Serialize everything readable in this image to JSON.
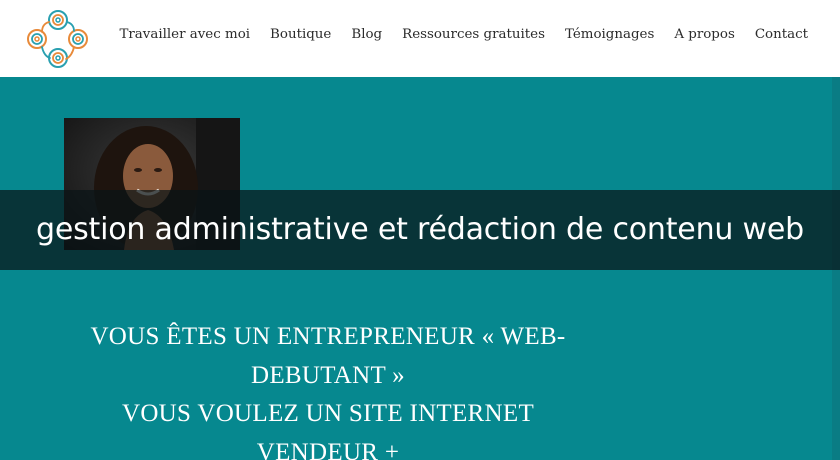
{
  "nav": {
    "items": [
      {
        "label": "Travailler avec moi"
      },
      {
        "label": "Boutique"
      },
      {
        "label": "Blog"
      },
      {
        "label": "Ressources gratuites"
      },
      {
        "label": "Témoignages"
      },
      {
        "label": "A propos"
      },
      {
        "label": "Contact"
      }
    ]
  },
  "logo": {
    "icon": "swirl-logo-icon"
  },
  "hero": {
    "caption": "gestion administrative et rédaction de contenu web",
    "headline_lines": [
      "VOUS ÊTES UN ENTREPRENEUR « WEB-",
      "DEBUTANT »",
      "VOUS VOULEZ UN SITE INTERNET",
      "VENDEUR +"
    ]
  },
  "colors": {
    "hero_bg": "#06888f",
    "logo_orange": "#e88a3a",
    "logo_teal": "#2aa0b0",
    "nav_text": "#2b2b2b"
  }
}
